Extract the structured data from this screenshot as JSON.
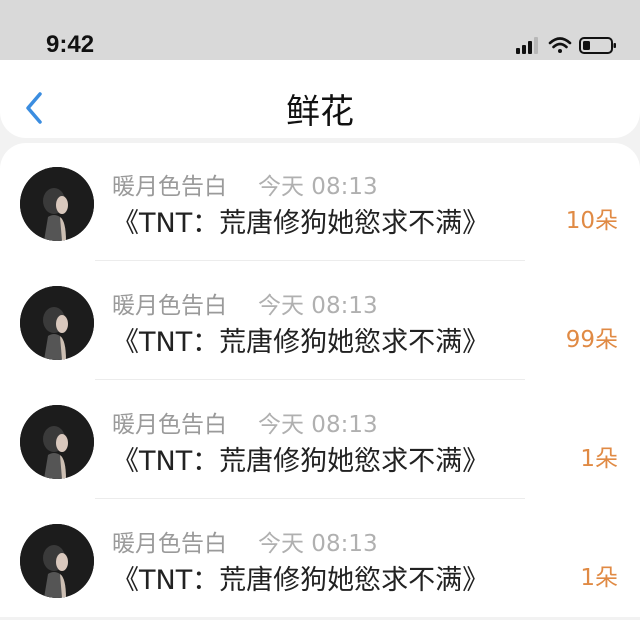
{
  "status": {
    "time": "9:42"
  },
  "header": {
    "title": "鲜花"
  },
  "colors": {
    "accent": "#e08a44",
    "back": "#3b8de0"
  },
  "items": [
    {
      "name": "暖月色告白",
      "time": "今天 08:13",
      "work": "《TNT：荒唐修狗她慾求不满》",
      "count": "10朵"
    },
    {
      "name": "暖月色告白",
      "time": "今天 08:13",
      "work": "《TNT：荒唐修狗她慾求不满》",
      "count": "99朵"
    },
    {
      "name": "暖月色告白",
      "time": "今天 08:13",
      "work": "《TNT：荒唐修狗她慾求不满》",
      "count": "1朵"
    },
    {
      "name": "暖月色告白",
      "time": "今天 08:13",
      "work": "《TNT：荒唐修狗她慾求不满》",
      "count": "1朵"
    }
  ]
}
